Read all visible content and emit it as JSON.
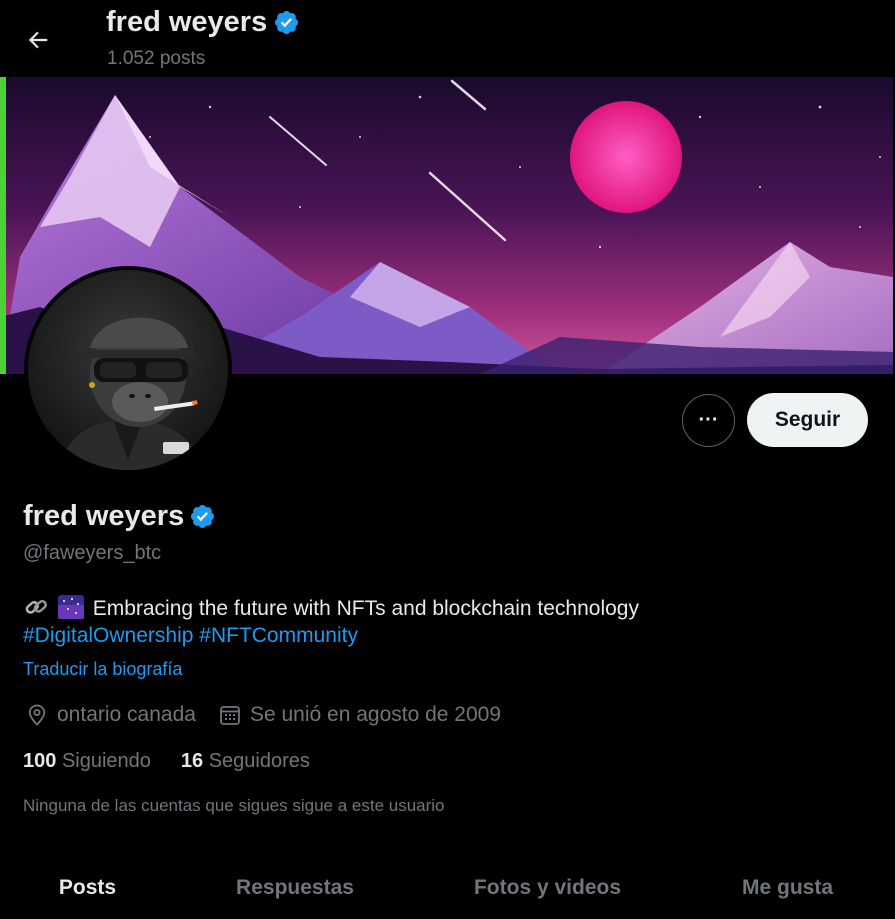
{
  "header": {
    "name": "fred weyers",
    "posts_count": "1.052 posts"
  },
  "profile": {
    "display_name": "fred weyers",
    "handle": "@faweyers_btc",
    "bio_text": "Embracing the future with NFTs and blockchain technology",
    "hashtags": [
      "#DigitalOwnership",
      "#NFTCommunity"
    ],
    "translate_label": "Traducir la biografía",
    "location": "ontario canada",
    "joined": "Se unió en agosto de 2009",
    "following_count": "100",
    "following_label": "Siguiendo",
    "followers_count": "16",
    "followers_label": "Seguidores",
    "followed_by_note": "Ninguna de las cuentas que sigues sigue a este usuario"
  },
  "actions": {
    "more_label": "···",
    "follow_label": "Seguir"
  },
  "tabs": [
    {
      "label": "Posts",
      "active": true
    },
    {
      "label": "Respuestas",
      "active": false
    },
    {
      "label": "Fotos y videos",
      "active": false
    },
    {
      "label": "Me gusta",
      "active": false
    }
  ],
  "icons": {
    "back": "arrow-left-icon",
    "verified": "verified-badge-icon",
    "location": "location-pin-icon",
    "calendar": "calendar-icon",
    "bio_emoji_1": "link-emoji",
    "bio_emoji_2": "night-sky-emoji"
  },
  "colors": {
    "background": "#000000",
    "text": "#e7e9ea",
    "muted": "#71767b",
    "accent": "#1d9bf0",
    "follow_button_bg": "#eff3f4"
  }
}
